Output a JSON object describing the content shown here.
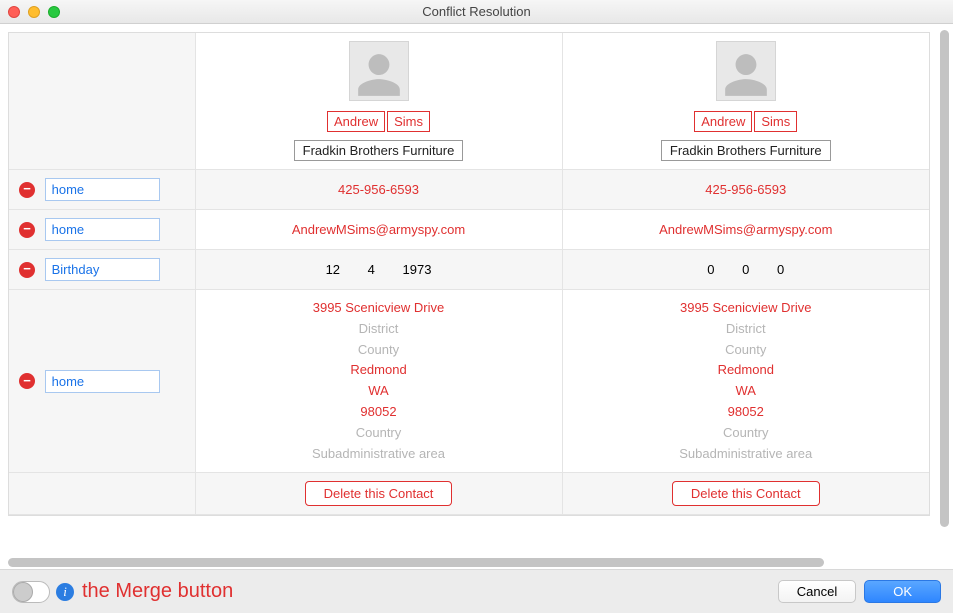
{
  "window": {
    "title": "Conflict Resolution"
  },
  "contact_left": {
    "first": "Andrew",
    "last": "Sims",
    "company": "Fradkin Brothers Furniture",
    "phone": "425-956-6593",
    "email": "AndrewMSims@armyspy.com",
    "birthday": {
      "m": "12",
      "d": "4",
      "y": "1973"
    },
    "address": {
      "street": "3995 Scenicview Drive",
      "district": "District",
      "county": "County",
      "city": "Redmond",
      "state": "WA",
      "zip": "98052",
      "country": "Country",
      "subadmin": "Subadministrative area"
    },
    "delete_label": "Delete this Contact"
  },
  "contact_right": {
    "first": "Andrew",
    "last": "Sims",
    "company": "Fradkin Brothers Furniture",
    "phone": "425-956-6593",
    "email": "AndrewMSims@armyspy.com",
    "birthday": {
      "m": "0",
      "d": "0",
      "y": "0"
    },
    "address": {
      "street": "3995 Scenicview Drive",
      "district": "District",
      "county": "County",
      "city": "Redmond",
      "state": "WA",
      "zip": "98052",
      "country": "Country",
      "subadmin": "Subadministrative area"
    },
    "delete_label": "Delete this Contact"
  },
  "labels": {
    "phone": "home",
    "email": "home",
    "birthday": "Birthday",
    "address": "home"
  },
  "footer": {
    "merge_hint": "the Merge button",
    "cancel": "Cancel",
    "ok": "OK"
  }
}
